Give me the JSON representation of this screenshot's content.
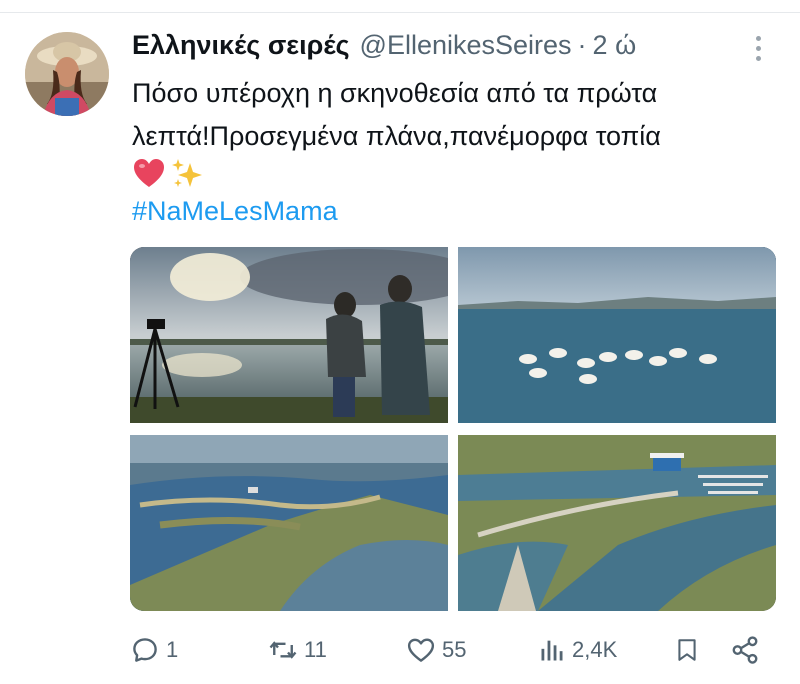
{
  "tweet": {
    "display_name": "Ελληνικές σειρές",
    "handle": "@EllenikesSeires",
    "separator": "·",
    "time": "2 ώ",
    "text_lines": [
      "Πόσο υπέροχη η σκηνοθεσία από τα πρώτα",
      "λεπτά!Προσεγμένα πλάνα,πανέμορφα τοπία"
    ],
    "emojis": [
      "heart-emoji",
      "sparkles-emoji"
    ],
    "hashtag": "#NaMeLesMama"
  },
  "media": {
    "images": [
      {
        "name": "media-lake-sunset-crew"
      },
      {
        "name": "media-pelicans-lake"
      },
      {
        "name": "media-aerial-lagoon-left"
      },
      {
        "name": "media-aerial-lagoon-right"
      }
    ]
  },
  "actions": {
    "replies": "1",
    "retweets": "11",
    "likes": "55",
    "views": "2,4K"
  },
  "icons": {
    "reply": "reply-icon",
    "retweet": "retweet-icon",
    "like": "heart-icon",
    "views": "views-icon",
    "bookmark": "bookmark-icon",
    "share": "share-icon",
    "more": "more-icon"
  },
  "colors": {
    "link": "#1d9bf0",
    "secondary": "#536471",
    "text": "#0f1419"
  }
}
